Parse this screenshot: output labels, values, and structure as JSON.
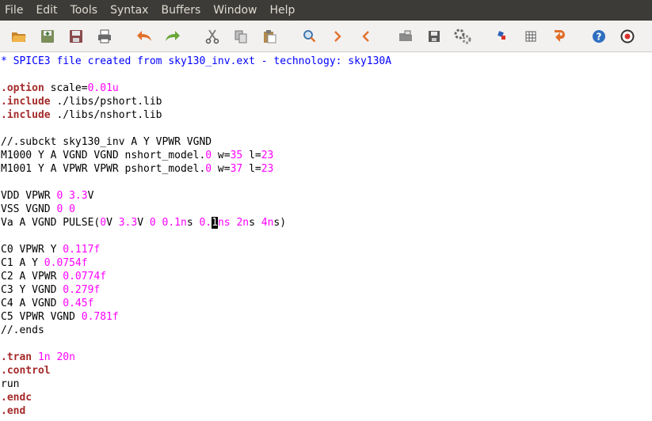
{
  "menubar": [
    "File",
    "Edit",
    "Tools",
    "Syntax",
    "Buffers",
    "Window",
    "Help"
  ],
  "toolbar_icons": [
    "open-file-icon",
    "save-icon",
    "save-all-icon",
    "print-icon",
    "undo-icon",
    "redo-icon",
    "cut-icon",
    "copy-icon",
    "paste-icon",
    "find-replace-icon",
    "find-next-icon",
    "find-previous-icon",
    "load-session-icon",
    "save-session-icon",
    "run-script-icon",
    "make-icon",
    "shell-icon",
    "ctags-jump-icon",
    "help-icon",
    "find-help-icon"
  ],
  "colors": {
    "keyword": "#a52a2a",
    "number": "#ff00ff",
    "comment": "#0000ff",
    "menubar_bg": "#3c3b37",
    "toolbar_bg": "#f2f1f0"
  },
  "editor": {
    "lines": [
      [
        {
          "t": "* SPICE3 file created from sky130_inv.ext - technology: sky130A",
          "c": "cmt"
        }
      ],
      [],
      [
        {
          "t": ".option",
          "c": "kw"
        },
        {
          "t": " scale="
        },
        {
          "t": "0.01u",
          "c": "num"
        }
      ],
      [
        {
          "t": ".include",
          "c": "kw"
        },
        {
          "t": " ./libs/pshort.lib"
        }
      ],
      [
        {
          "t": ".include",
          "c": "kw"
        },
        {
          "t": " ./libs/nshort.lib"
        }
      ],
      [],
      [
        {
          "t": "//.subckt sky130_inv A Y VPWR VGND"
        }
      ],
      [
        {
          "t": "M1000 Y A VGND VGND nshort_model."
        },
        {
          "t": "0",
          "c": "num"
        },
        {
          "t": " w="
        },
        {
          "t": "35",
          "c": "num"
        },
        {
          "t": " l="
        },
        {
          "t": "23",
          "c": "num"
        }
      ],
      [
        {
          "t": "M1001 Y A VPWR VPWR pshort_model."
        },
        {
          "t": "0",
          "c": "num"
        },
        {
          "t": " w="
        },
        {
          "t": "37",
          "c": "num"
        },
        {
          "t": " l="
        },
        {
          "t": "23",
          "c": "num"
        }
      ],
      [],
      [
        {
          "t": "VDD VPWR "
        },
        {
          "t": "0",
          "c": "num"
        },
        {
          "t": " "
        },
        {
          "t": "3.3",
          "c": "num"
        },
        {
          "t": "V"
        }
      ],
      [
        {
          "t": "VSS VGND "
        },
        {
          "t": "0",
          "c": "num"
        },
        {
          "t": " "
        },
        {
          "t": "0",
          "c": "num"
        }
      ],
      [
        {
          "t": "Va A VGND PULSE("
        },
        {
          "t": "0",
          "c": "num"
        },
        {
          "t": "V "
        },
        {
          "t": "3.3",
          "c": "num"
        },
        {
          "t": "V "
        },
        {
          "t": "0",
          "c": "num"
        },
        {
          "t": " "
        },
        {
          "t": "0.1n",
          "c": "num"
        },
        {
          "t": "s "
        },
        {
          "t": "0.",
          "c": "num"
        },
        {
          "t": "1",
          "c": "cursor"
        },
        {
          "t": "ns ",
          "c": "num"
        },
        {
          "t": "2n",
          "c": "num"
        },
        {
          "t": "s "
        },
        {
          "t": "4n",
          "c": "num"
        },
        {
          "t": "s)"
        }
      ],
      [],
      [
        {
          "t": "C0 VPWR Y "
        },
        {
          "t": "0.117f",
          "c": "num"
        }
      ],
      [
        {
          "t": "C1 A Y "
        },
        {
          "t": "0.0754f",
          "c": "num"
        }
      ],
      [
        {
          "t": "C2 A VPWR "
        },
        {
          "t": "0.0774f",
          "c": "num"
        }
      ],
      [
        {
          "t": "C3 Y VGND "
        },
        {
          "t": "0.279f",
          "c": "num"
        }
      ],
      [
        {
          "t": "C4 A VGND "
        },
        {
          "t": "0.45f",
          "c": "num"
        }
      ],
      [
        {
          "t": "C5 VPWR VGND "
        },
        {
          "t": "0.781f",
          "c": "num"
        }
      ],
      [
        {
          "t": "//.ends"
        }
      ],
      [],
      [
        {
          "t": ".tran",
          "c": "kw"
        },
        {
          "t": " "
        },
        {
          "t": "1n",
          "c": "num"
        },
        {
          "t": " "
        },
        {
          "t": "20n",
          "c": "num"
        }
      ],
      [
        {
          "t": ".control",
          "c": "kw"
        }
      ],
      [
        {
          "t": "run"
        }
      ],
      [
        {
          "t": ".endc",
          "c": "kw"
        }
      ],
      [
        {
          "t": ".end",
          "c": "kw"
        }
      ]
    ]
  }
}
